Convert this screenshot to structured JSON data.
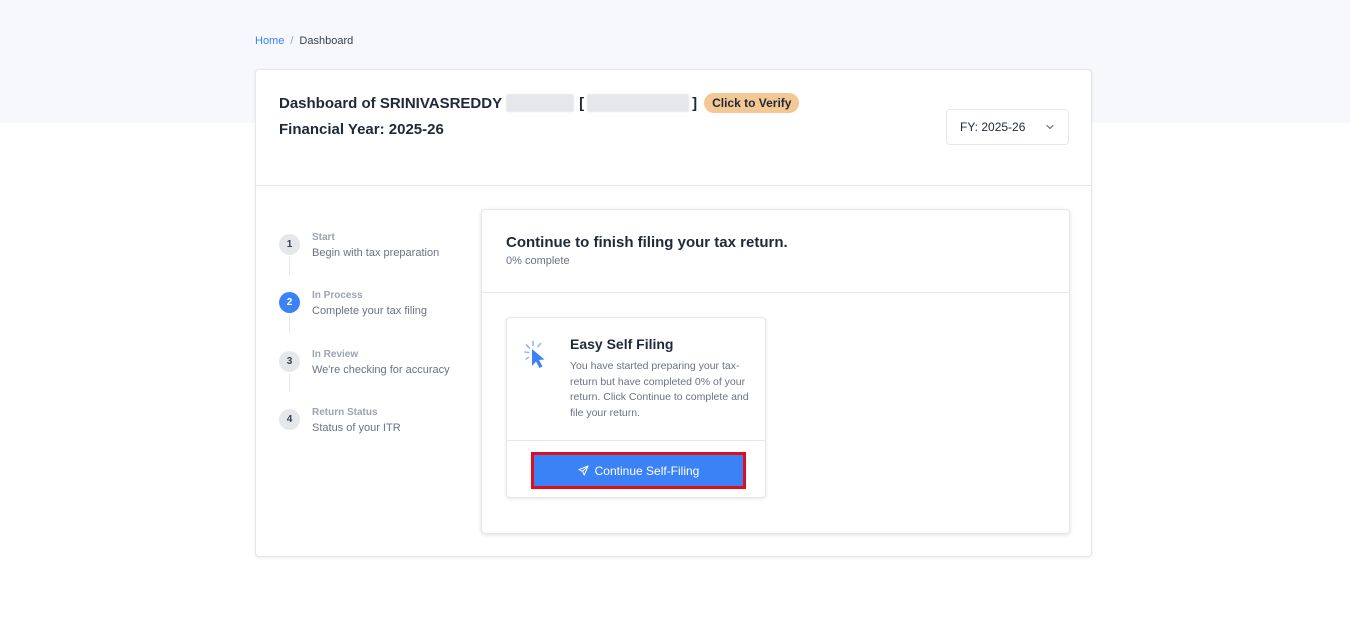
{
  "breadcrumb": {
    "home": "Home",
    "separator": "/",
    "current": "Dashboard"
  },
  "header": {
    "title_prefix": "Dashboard of SRINIVASREDDY",
    "bracket_open": "[",
    "bracket_close": "]",
    "verify_label": "Click to Verify",
    "financial_year_label": "Financial Year: 2025-26"
  },
  "fy_select": {
    "value": "FY: 2025-26",
    "icon": "chevron-down-icon"
  },
  "steps": [
    {
      "number": "1",
      "label": "Start",
      "desc": "Begin with tax preparation"
    },
    {
      "number": "2",
      "label": "In Process",
      "desc": "Complete your tax filing"
    },
    {
      "number": "3",
      "label": "In Review",
      "desc": "We're checking for accuracy"
    },
    {
      "number": "4",
      "label": "Return Status",
      "desc": "Status of your ITR"
    }
  ],
  "progress_card": {
    "title": "Continue to finish filing your tax return.",
    "progress_text": "0% complete",
    "progress_percent": 0
  },
  "option": {
    "icon": "cursor-click-icon",
    "title": "Easy Self Filing",
    "desc": "You have started preparing your tax-return but have completed 0% of your return. Click Continue to complete and file your return.",
    "button_label": "Continue Self-Filing",
    "button_icon": "send-icon"
  },
  "colors": {
    "accent": "#3b82f6",
    "badge": "#f4c893",
    "highlight_border": "#e00d1a"
  }
}
